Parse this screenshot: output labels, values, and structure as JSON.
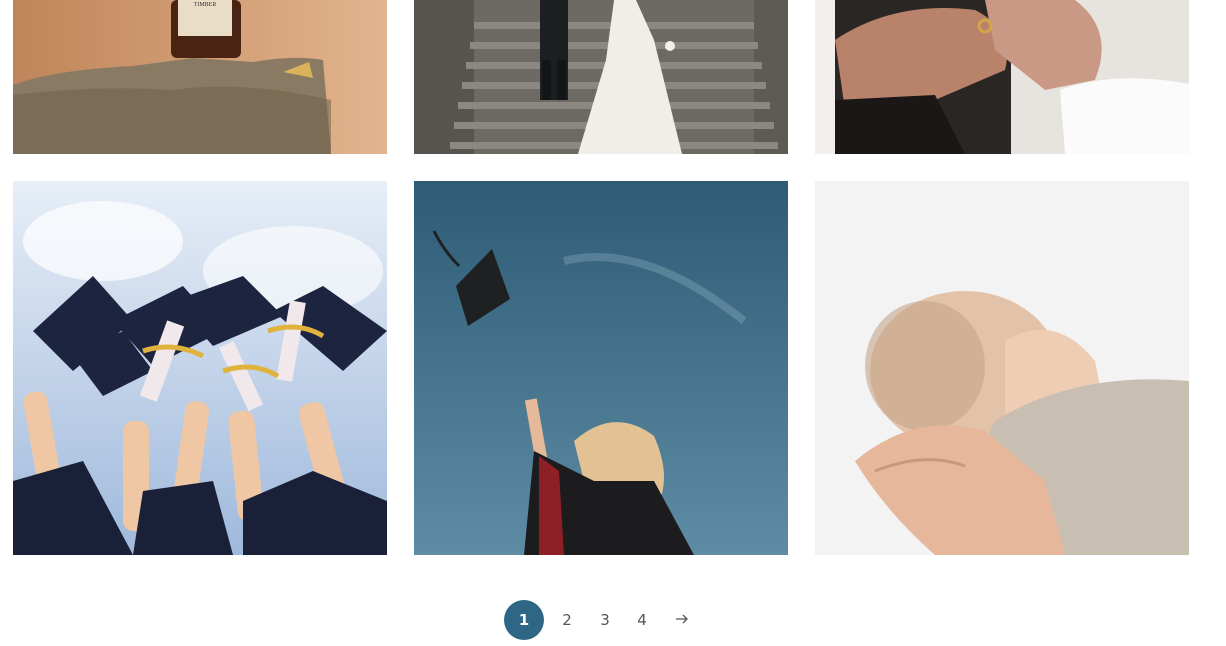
{
  "gallery": {
    "images": [
      {
        "name": "serum-bottle-on-rock",
        "label": "TIMBER"
      },
      {
        "name": "wedding-couple-on-stairs"
      },
      {
        "name": "hands-with-wedding-ring"
      },
      {
        "name": "graduation-caps-raised"
      },
      {
        "name": "graduate-tossing-cap"
      },
      {
        "name": "newborn-baby-in-hands"
      }
    ]
  },
  "pagination": {
    "current": "1",
    "pages": [
      "1",
      "2",
      "3",
      "4"
    ],
    "next_icon": "arrow-right-icon",
    "accent_color": "#2f6685"
  }
}
